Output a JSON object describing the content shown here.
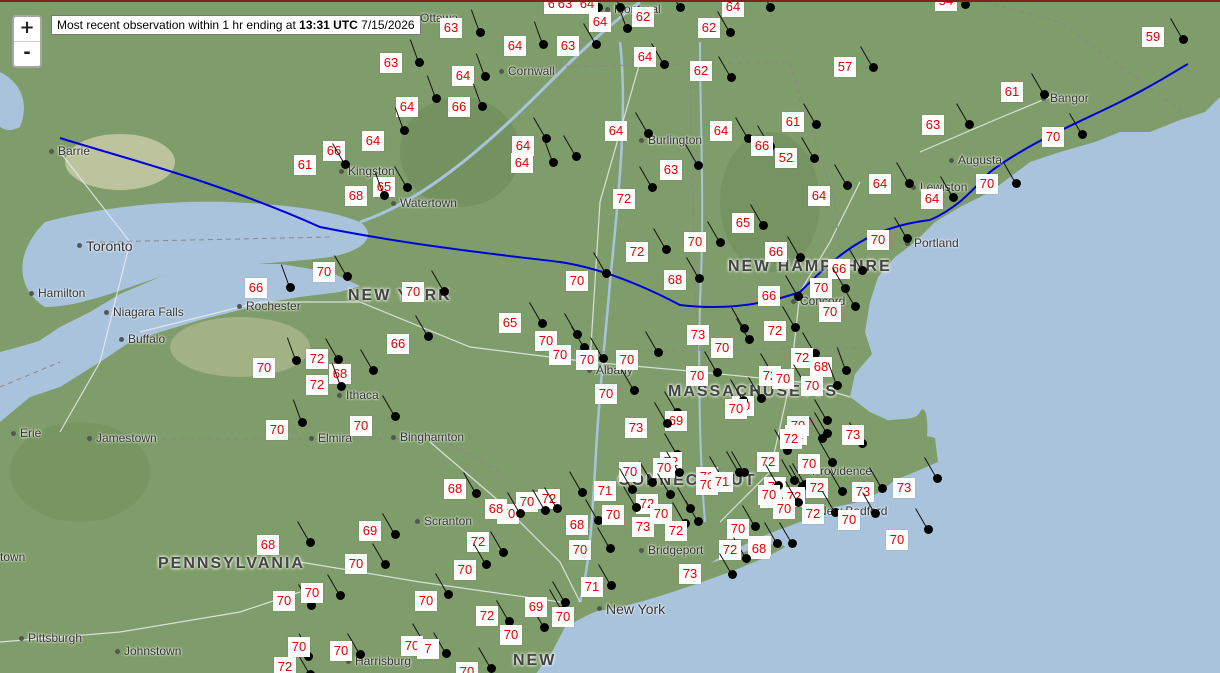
{
  "banner": {
    "prefix": "Most recent observation within 1 hr ending at ",
    "time": "13:31 UTC",
    "date": " 7/15/2026"
  },
  "zoom": {
    "in_label": "+",
    "out_label": "-"
  },
  "colors": {
    "water": "#a9c3dc",
    "land": "#7f9d6a",
    "front": "#0000dd",
    "temp_text": "#e00000"
  },
  "states": [
    "NEW YORK",
    "NEW HAMPSHIRE",
    "MASSACHUSETTS",
    "CONNECTICUT",
    "PENNSYLVANIA",
    "NEW"
  ],
  "places": [
    "Ottawa",
    "Montreal",
    "Cornwall",
    "Burlington",
    "Barrie",
    "Toronto",
    "Kingston",
    "Watertown",
    "Hamilton",
    "Niagara Falls",
    "Buffalo",
    "Rochester",
    "Ithaca",
    "Elmira",
    "Binghamton",
    "Jamestown",
    "Erie",
    "Albany",
    "Concord",
    "Portland",
    "Lewiston",
    "Augusta",
    "Bangor",
    "Scranton",
    "Bridgeport",
    "New York",
    "Pittsburgh",
    "Johnstown",
    "Harrisburg",
    "Providence",
    "New Bedford",
    "town"
  ],
  "observations": [
    {
      "t": "62"
    },
    {
      "t": "63"
    },
    {
      "t": "64"
    },
    {
      "t": "62"
    },
    {
      "t": "64"
    },
    {
      "t": "54"
    },
    {
      "t": "63"
    },
    {
      "t": "64"
    },
    {
      "t": "64"
    },
    {
      "t": "63"
    },
    {
      "t": "62"
    },
    {
      "t": "59"
    },
    {
      "t": "63"
    },
    {
      "t": "64"
    },
    {
      "t": "64"
    },
    {
      "t": "62"
    },
    {
      "t": "57"
    },
    {
      "t": "64"
    },
    {
      "t": "66"
    },
    {
      "t": "61"
    },
    {
      "t": "64"
    },
    {
      "t": "64"
    },
    {
      "t": "61"
    },
    {
      "t": "63"
    },
    {
      "t": "64"
    },
    {
      "t": "64"
    },
    {
      "t": "64"
    },
    {
      "t": "66"
    },
    {
      "t": "52"
    },
    {
      "t": "70"
    },
    {
      "t": "66"
    },
    {
      "t": "61"
    },
    {
      "t": "65"
    },
    {
      "t": "68"
    },
    {
      "t": "63"
    },
    {
      "t": "72"
    },
    {
      "t": "64"
    },
    {
      "t": "70"
    },
    {
      "t": "65"
    },
    {
      "t": "64"
    },
    {
      "t": "64"
    },
    {
      "t": "70"
    },
    {
      "t": "70"
    },
    {
      "t": "66"
    },
    {
      "t": "72"
    },
    {
      "t": "66"
    },
    {
      "t": "70"
    },
    {
      "t": "68"
    },
    {
      "t": "70"
    },
    {
      "t": "66"
    },
    {
      "t": "70"
    },
    {
      "t": "66"
    },
    {
      "t": "70"
    },
    {
      "t": "70"
    },
    {
      "t": "65"
    },
    {
      "t": "66"
    },
    {
      "t": "73"
    },
    {
      "t": "72"
    },
    {
      "t": "70"
    },
    {
      "t": "70"
    },
    {
      "t": "70"
    },
    {
      "t": "70"
    },
    {
      "t": "70"
    },
    {
      "t": "72"
    },
    {
      "t": "72"
    },
    {
      "t": "68"
    },
    {
      "t": "70"
    },
    {
      "t": "72"
    },
    {
      "t": "70"
    },
    {
      "t": "70"
    },
    {
      "t": "68"
    },
    {
      "t": "70"
    },
    {
      "t": "70"
    },
    {
      "t": "72"
    },
    {
      "t": "70"
    },
    {
      "t": "69"
    },
    {
      "t": "70"
    },
    {
      "t": "73"
    },
    {
      "t": "70"
    },
    {
      "t": "71"
    },
    {
      "t": "70"
    },
    {
      "t": "70"
    },
    {
      "t": "72"
    },
    {
      "t": "72"
    },
    {
      "t": "72"
    },
    {
      "t": "73"
    },
    {
      "t": "72"
    },
    {
      "t": "70"
    },
    {
      "t": "70"
    },
    {
      "t": "70"
    },
    {
      "t": "72"
    },
    {
      "t": "70"
    },
    {
      "t": "72"
    },
    {
      "t": "70"
    },
    {
      "t": "73"
    },
    {
      "t": "70"
    },
    {
      "t": "72"
    },
    {
      "t": "73"
    },
    {
      "t": "72"
    },
    {
      "t": "70"
    },
    {
      "t": "71"
    },
    {
      "t": "70"
    },
    {
      "t": "70"
    },
    {
      "t": "70"
    },
    {
      "t": "72"
    },
    {
      "t": "68"
    },
    {
      "t": "70"
    },
    {
      "t": "68"
    },
    {
      "t": "71"
    },
    {
      "t": "72"
    },
    {
      "t": "70"
    },
    {
      "t": "73"
    },
    {
      "t": "70"
    },
    {
      "t": "72"
    },
    {
      "t": "74"
    },
    {
      "t": "68"
    },
    {
      "t": "70"
    },
    {
      "t": "69"
    },
    {
      "t": "72"
    },
    {
      "t": "70"
    },
    {
      "t": "70"
    },
    {
      "t": "72"
    },
    {
      "t": "73"
    },
    {
      "t": "68"
    },
    {
      "t": "70"
    },
    {
      "t": "68"
    },
    {
      "t": "70"
    },
    {
      "t": "72"
    },
    {
      "t": "70"
    },
    {
      "t": "69"
    },
    {
      "t": "70"
    },
    {
      "t": "71"
    },
    {
      "t": "70"
    },
    {
      "t": "70"
    },
    {
      "t": "70"
    },
    {
      "t": "7"
    },
    {
      "t": "70"
    },
    {
      "t": "72"
    },
    {
      "t": "70"
    },
    {
      "t": "70"
    }
  ]
}
